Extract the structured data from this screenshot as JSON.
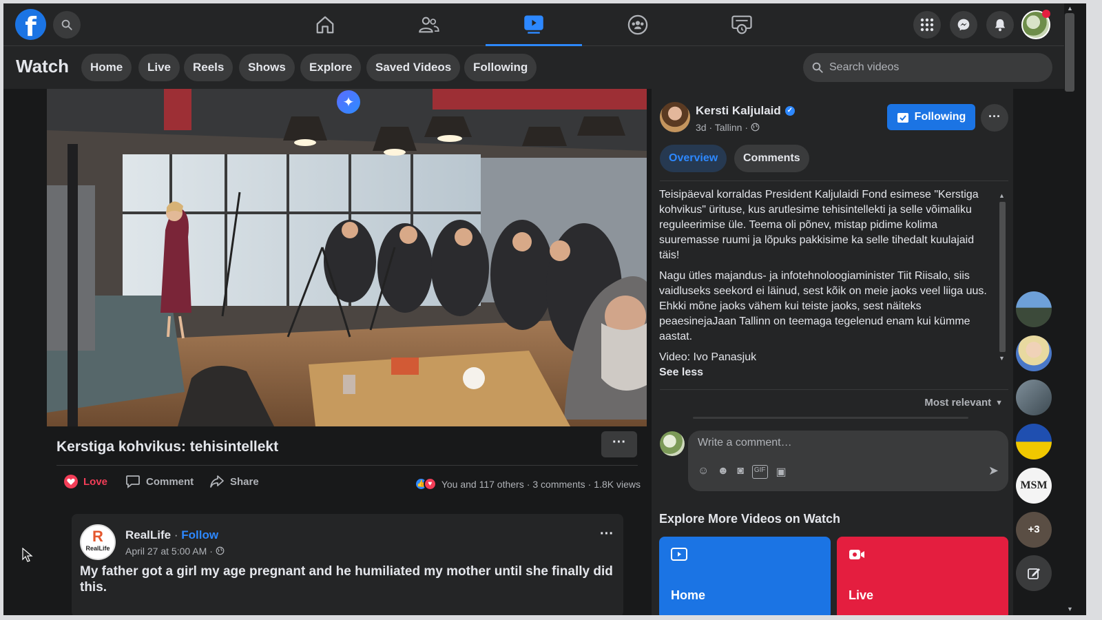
{
  "topnav": {
    "logo": "f",
    "tabs": [
      {
        "icon": "home-icon"
      },
      {
        "icon": "friends-icon"
      },
      {
        "icon": "watch-icon",
        "active": true
      },
      {
        "icon": "groups-icon"
      },
      {
        "icon": "gaming-icon"
      }
    ],
    "right_icons": [
      "menu-grid-icon",
      "messenger-icon",
      "notifications-icon",
      "profile-avatar"
    ]
  },
  "subbar": {
    "title": "Watch",
    "pills": [
      "Home",
      "Live",
      "Reels",
      "Shows",
      "Explore",
      "Saved Videos",
      "Following"
    ],
    "search_placeholder": "Search videos"
  },
  "video": {
    "title": "Kerstiga kohvikus: tehisintellekt",
    "actions": {
      "love": "Love",
      "comment": "Comment",
      "share": "Share"
    },
    "reactions": "You and 117 others",
    "comments": "3 comments",
    "views": "1.8K views",
    "separator": "·"
  },
  "post": {
    "page_name": "RealLife",
    "follow": "Follow",
    "avatar_letter": "R",
    "avatar_text": "RealLife",
    "meta": "April 27 at 5:00 AM",
    "text": "My father got a girl my age pregnant and he humiliated my mother until she finally did this."
  },
  "author": {
    "name": "Kersti Kaljulaid",
    "meta": "3d · Tallinn ·",
    "following_label": "Following",
    "tabs": {
      "overview": "Overview",
      "comments": "Comments"
    }
  },
  "description": {
    "p1": "Teisipäeval korraldas President Kaljulaidi Fond esimese \"Kerstiga kohvikus\" ürituse, kus arutlesime tehisintellekti ja selle võimaliku reguleerimise üle. Teema oli põnev, mistap pidime kolima suuremasse ruumi ja lõpuks pakkisime ka selle tihedalt kuulajaid täis!",
    "p2": "Nagu ütles majandus- ja infotehnoloogiaminister Tiit Riisalo, siis vaidluseks seekord ei läinud, sest kõik on meie jaoks veel liiga uus. Ehkki mõne jaoks vähem kui teiste jaoks, sest näiteks peaesinejaJaan Tallinn on teemaga tegelenud enam kui kümme aastat.",
    "p3": "Video: Ivo Panasjuk",
    "see_less": "See less"
  },
  "comments": {
    "sort_label": "Most relevant",
    "placeholder": "Write a comment…"
  },
  "explore": {
    "title": "Explore More Videos on Watch",
    "tiles": [
      {
        "label": "Home",
        "color": "#1b74e4"
      },
      {
        "label": "Live",
        "color": "#e41e3f"
      }
    ]
  },
  "contacts": {
    "more_count": "+3"
  }
}
